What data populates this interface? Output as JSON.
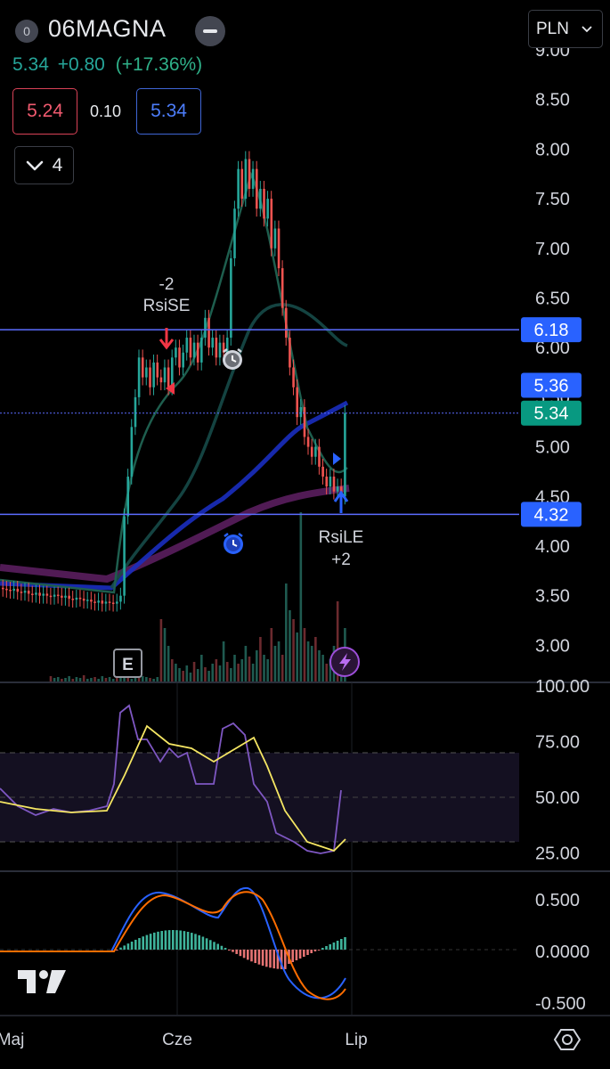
{
  "header": {
    "badge": "0",
    "symbol": "06MAGNA",
    "price": "5.34",
    "change": "+0.80",
    "change_pct": "(+17.36%)",
    "sell_price": "5.24",
    "spread": "0.10",
    "buy_price": "5.34",
    "indicators_count": "4",
    "currency": "PLN"
  },
  "price_axis": [
    "9.00",
    "8.50",
    "8.00",
    "7.50",
    "7.00",
    "6.50",
    "6.00",
    "5.50",
    "5.00",
    "4.50",
    "4.00",
    "3.50",
    "3.00"
  ],
  "price_tags": [
    {
      "label": "6.18",
      "color": "#2962ff"
    },
    {
      "label": "5.36",
      "color": "#2962ff"
    },
    {
      "label": "5.34",
      "color": "#089981"
    },
    {
      "label": "4.32",
      "color": "#2962ff"
    }
  ],
  "signals": {
    "short_qty": "-2",
    "short_name": "RsiSE",
    "long_name": "RsiLE",
    "long_qty": "+2",
    "earnings_badge": "E"
  },
  "rsi_axis": [
    "100.00",
    "75.00",
    "50.00",
    "25.00"
  ],
  "macd_axis": [
    "0.500",
    "0.0000",
    "-0.500"
  ],
  "time_axis": [
    "Maj",
    "Cze",
    "Lip"
  ],
  "colors": {
    "up": "#26a69a",
    "down": "#ef5350",
    "hline": "#5b6cff",
    "ema_fast": "#1e5e4e",
    "ema_mid": "#164a48",
    "ema_blue": "#1a2dbf",
    "ema_purple": "#5a1e5e",
    "rsi": "#7e57c2",
    "rsi_ma": "#f5e663",
    "macd": "#2962ff",
    "macd_signal": "#ff6d00"
  },
  "icons": [
    "alarm-icon",
    "lightning-icon",
    "chevron-down-icon",
    "settings-icon",
    "tradingview-logo"
  ]
}
